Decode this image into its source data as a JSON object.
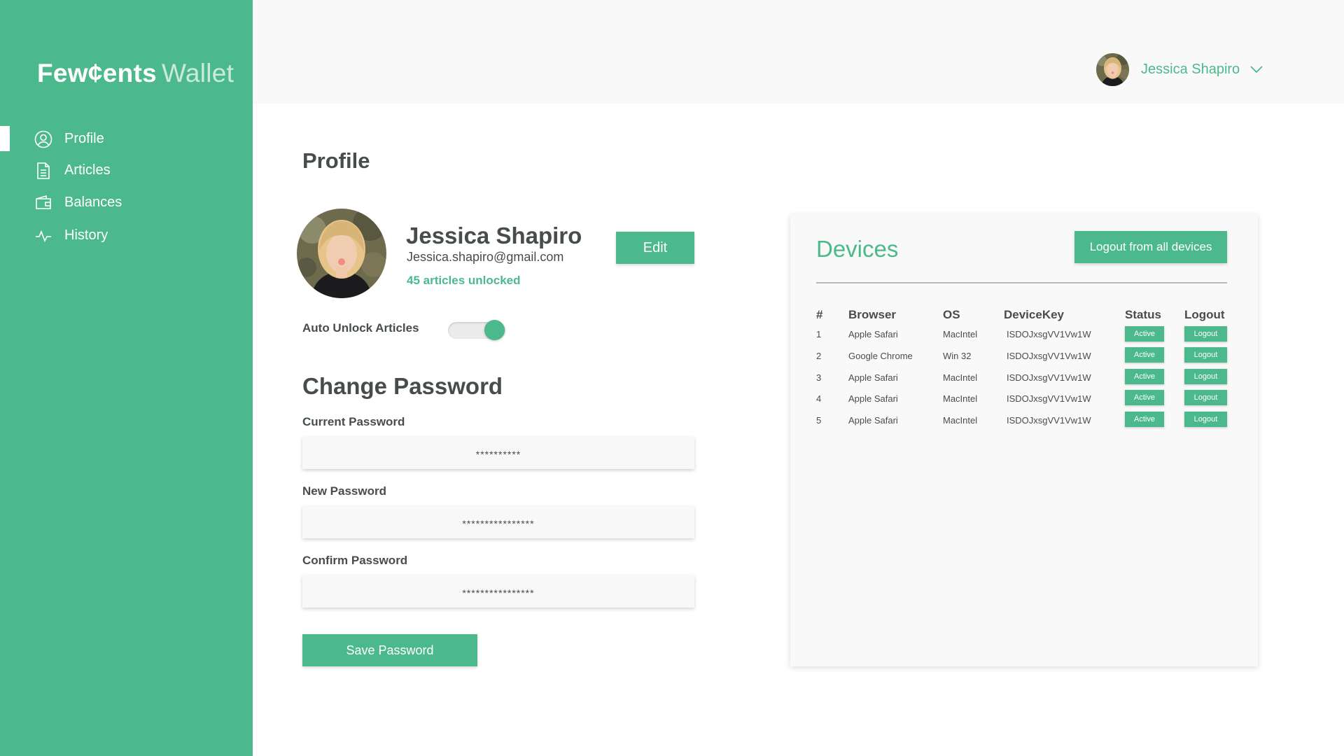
{
  "app": {
    "brand": "Few¢ents",
    "brand_suffix": "Wallet"
  },
  "sidebar": {
    "items": [
      {
        "label": "Profile",
        "icon": "user-circle-icon",
        "active": true
      },
      {
        "label": "Articles",
        "icon": "document-icon",
        "active": false
      },
      {
        "label": "Balances",
        "icon": "wallet-icon",
        "active": false
      },
      {
        "label": "History",
        "icon": "activity-icon",
        "active": false
      }
    ]
  },
  "header": {
    "user_name": "Jessica Shapiro"
  },
  "profile": {
    "page_title": "Profile",
    "name": "Jessica Shapiro",
    "email": "Jessica.shapiro@gmail.com",
    "articles_unlocked": "45 articles unlocked",
    "edit_label": "Edit",
    "auto_unlock_label": "Auto Unlock Articles",
    "auto_unlock_on": true
  },
  "change_password": {
    "title": "Change Password",
    "current_label": "Current Password",
    "current_value": "**********",
    "new_label": "New Password",
    "new_value": "****************",
    "confirm_label": "Confirm Password",
    "confirm_value": "****************",
    "save_label": "Save Password"
  },
  "devices": {
    "title": "Devices",
    "logout_all_label": "Logout from all devices",
    "columns": [
      "#",
      "Browser",
      "OS",
      "DeviceKey",
      "Status",
      "Logout"
    ],
    "rows": [
      {
        "num": "1",
        "browser": "Apple Safari",
        "os": "MacIntel",
        "key": "ISDOJxsgVV1Vw1W",
        "status": "Active",
        "logout": "Logout"
      },
      {
        "num": "2",
        "browser": "Google Chrome",
        "os": "Win 32",
        "key": "ISDOJxsgVV1Vw1W",
        "status": "Active",
        "logout": "Logout"
      },
      {
        "num": "3",
        "browser": "Apple Safari",
        "os": "MacIntel",
        "key": "ISDOJxsgVV1Vw1W",
        "status": "Active",
        "logout": "Logout"
      },
      {
        "num": "4",
        "browser": "Apple Safari",
        "os": "MacIntel",
        "key": "ISDOJxsgVV1Vw1W",
        "status": "Active",
        "logout": "Logout"
      },
      {
        "num": "5",
        "browser": "Apple Safari",
        "os": "MacIntel",
        "key": "ISDOJxsgVV1Vw1W",
        "status": "Active",
        "logout": "Logout"
      }
    ]
  },
  "colors": {
    "accent": "#4cb98c",
    "text": "#474d4a",
    "panel": "#f9f9f9"
  }
}
